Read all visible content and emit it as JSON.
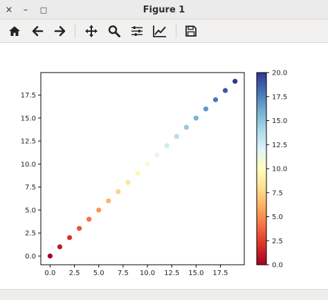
{
  "window": {
    "title": "Figure 1",
    "close_symbol": "×",
    "minimize_symbol": "–",
    "maximize_symbol": "□"
  },
  "toolbar": {
    "icons": [
      "home-icon",
      "back-arrow-icon",
      "forward-arrow-icon",
      "pan-icon",
      "zoom-icon",
      "configure-subplots-icon",
      "edit-axis-icon",
      "save-icon"
    ]
  },
  "chart_data": {
    "type": "scatter",
    "x": [
      0,
      1,
      2,
      3,
      4,
      5,
      6,
      7,
      8,
      9,
      10,
      11,
      12,
      13,
      14,
      15,
      16,
      17,
      18,
      19
    ],
    "y": [
      0,
      1,
      2,
      3,
      4,
      5,
      6,
      7,
      8,
      9,
      10,
      11,
      12,
      13,
      14,
      15,
      16,
      17,
      18,
      19
    ],
    "c": [
      0,
      1,
      2,
      3,
      4,
      5,
      6,
      7,
      8,
      9,
      10,
      11,
      12,
      13,
      14,
      15,
      16,
      17,
      18,
      19
    ],
    "colormap": "RdYlBu",
    "xlim": [
      -0.95,
      19.95
    ],
    "ylim": [
      -0.95,
      19.95
    ],
    "xticks": [
      0.0,
      2.5,
      5.0,
      7.5,
      10.0,
      12.5,
      15.0,
      17.5
    ],
    "xtick_labels": [
      "0.0",
      "2.5",
      "5.0",
      "7.5",
      "10.0",
      "12.5",
      "15.0",
      "17.5"
    ],
    "yticks": [
      0.0,
      2.5,
      5.0,
      7.5,
      10.0,
      12.5,
      15.0,
      17.5
    ],
    "ytick_labels": [
      "0.0",
      "2.5",
      "5.0",
      "7.5",
      "10.0",
      "12.5",
      "15.0",
      "17.5"
    ],
    "colorbar": {
      "range": [
        0,
        20
      ],
      "ticks": [
        0.0,
        2.5,
        5.0,
        7.5,
        10.0,
        12.5,
        15.0,
        17.5,
        20.0
      ],
      "tick_labels": [
        "0.0",
        "2.5",
        "5.0",
        "7.5",
        "10.0",
        "12.5",
        "15.0",
        "17.5",
        "20.0"
      ]
    },
    "grid": false,
    "title": "",
    "xlabel": "",
    "ylabel": ""
  }
}
